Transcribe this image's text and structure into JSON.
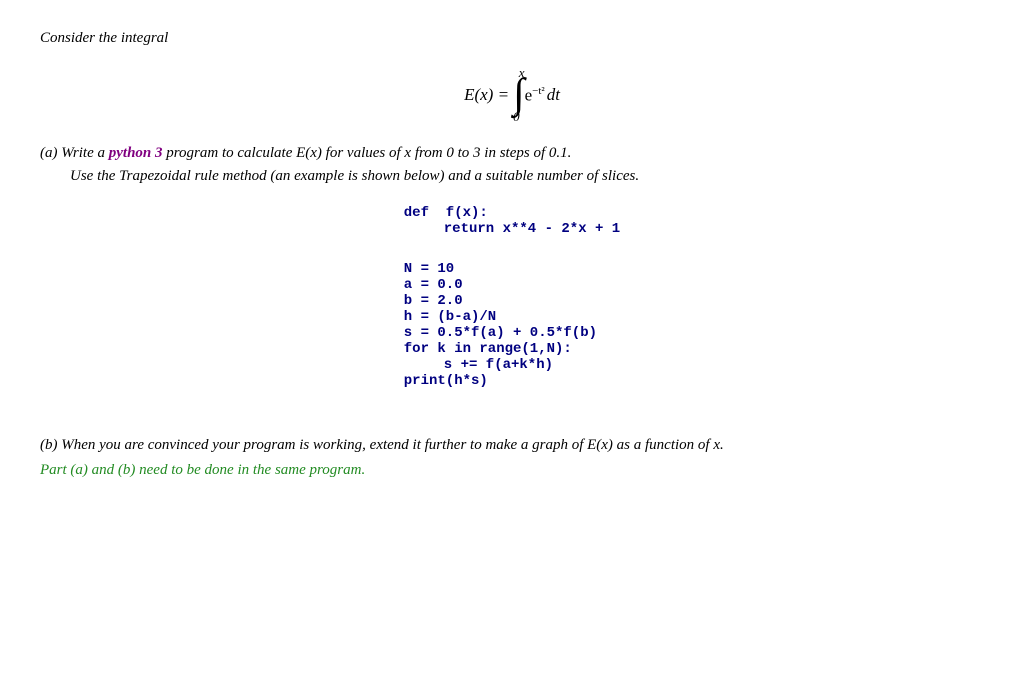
{
  "intro": {
    "text": "Consider the integral"
  },
  "math": {
    "lhs": "E(x) =",
    "upper_bound": "x",
    "lower_bound": "0",
    "integrand": "e",
    "exponent": "−t²",
    "dt": "dt"
  },
  "part_a": {
    "label_start": "(a) Write a ",
    "python3": "python 3",
    "label_mid": " program to calculate ",
    "math_ex": "E(x)",
    "label_mid2": " for values of ",
    "math_x": "x",
    "label_mid3": " from 0 to 3 in steps of 0.1.",
    "subtext": "Use the Trapezoidal rule method (an example is shown below) and a suitable number of slices."
  },
  "code": {
    "lines": [
      {
        "text": "def  f(x):",
        "indent": 0
      },
      {
        "text": "return x**4 - 2*x + 1",
        "indent": 1
      },
      {
        "text": "",
        "indent": 0
      },
      {
        "text": "",
        "indent": 0
      },
      {
        "text": "N = 10",
        "indent": 0
      },
      {
        "text": "a = 0.0",
        "indent": 0
      },
      {
        "text": "b = 2.0",
        "indent": 0
      },
      {
        "text": "h = (b-a)/N",
        "indent": 0
      },
      {
        "text": "s = 0.5*f(a) + 0.5*f(b)",
        "indent": 0
      },
      {
        "text": "for k in range(1,N):",
        "indent": 0
      },
      {
        "text": "s += f(a+k*h)",
        "indent": 1
      },
      {
        "text": "print(h*s)",
        "indent": 0
      }
    ]
  },
  "part_b": {
    "text": "(b) When you are convinced your program is working, extend it further to make a graph of E(x) as a function of x."
  },
  "note": {
    "text": "Part (a) and (b) need to be done in the same program."
  }
}
